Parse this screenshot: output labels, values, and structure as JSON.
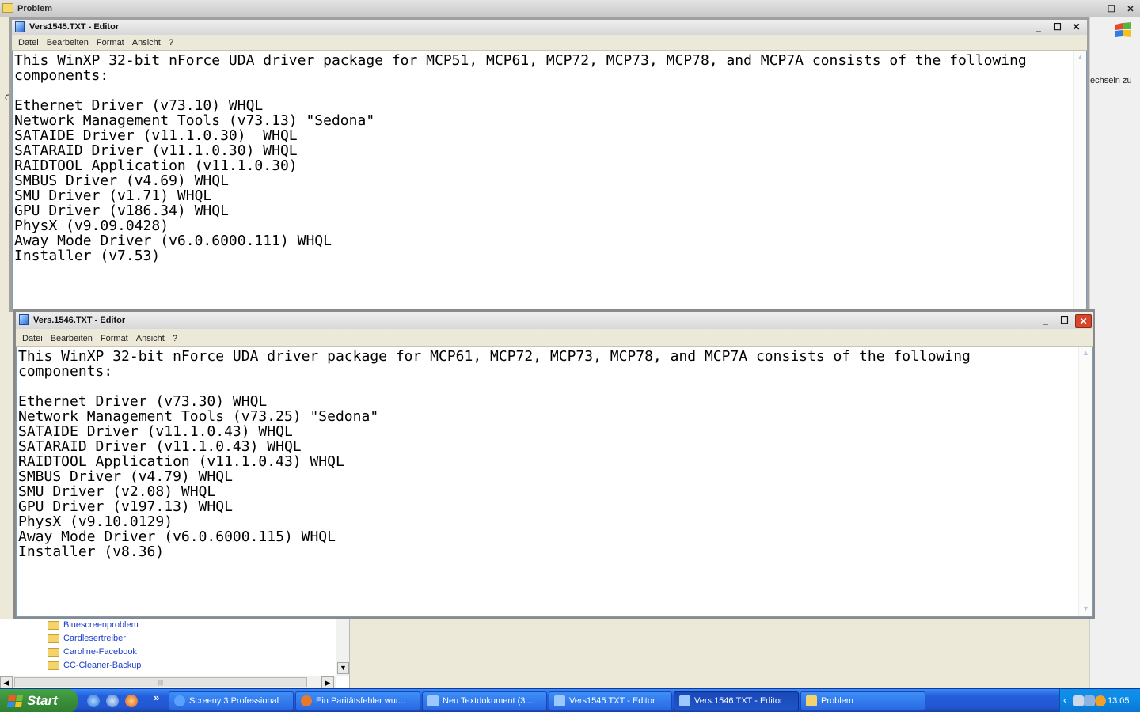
{
  "explorer": {
    "title": "Problem",
    "side_text": "echseln zu",
    "side_left_letter": "O",
    "tree_items": [
      "Bluescreenproblem",
      "Cardlesertreiber",
      "Caroline-Facebook",
      "CC-Cleaner-Backup"
    ]
  },
  "window1": {
    "title": "Vers1545.TXT - Editor",
    "menu": [
      "Datei",
      "Bearbeiten",
      "Format",
      "Ansicht",
      "?"
    ],
    "content": "This WinXP 32-bit nForce UDA driver package for MCP51, MCP61, MCP72, MCP73, MCP78, and MCP7A consists of the following\ncomponents:\n\nEthernet Driver (v73.10) WHQL\nNetwork Management Tools (v73.13) \"Sedona\"\nSATAIDE Driver (v11.1.0.30)  WHQL\nSATARAID Driver (v11.1.0.30) WHQL\nRAIDTOOL Application (v11.1.0.30)\nSMBUS Driver (v4.69) WHQL\nSMU Driver (v1.71) WHQL\nGPU Driver (v186.34) WHQL\nPhysX (v9.09.0428)\nAway Mode Driver (v6.0.6000.111) WHQL\nInstaller (v7.53)"
  },
  "window2": {
    "title": "Vers.1546.TXT - Editor",
    "menu": [
      "Datei",
      "Bearbeiten",
      "Format",
      "Ansicht",
      "?"
    ],
    "content": "This WinXP 32-bit nForce UDA driver package for MCP61, MCP72, MCP73, MCP78, and MCP7A consists of the following\ncomponents:\n\nEthernet Driver (v73.30) WHQL\nNetwork Management Tools (v73.25) \"Sedona\"\nSATAIDE Driver (v11.1.0.43) WHQL\nSATARAID Driver (v11.1.0.43) WHQL\nRAIDTOOL Application (v11.1.0.43) WHQL\nSMBUS Driver (v4.79) WHQL\nSMU Driver (v2.08) WHQL\nGPU Driver (v197.13) WHQL\nPhysX (v9.10.0129)\nAway Mode Driver (v6.0.6000.115) WHQL\nInstaller (v8.36)"
  },
  "taskbar": {
    "start_label": "Start",
    "overflow": "»",
    "buttons": [
      {
        "label": "Screeny 3 Professional",
        "icon": "screeny-icon",
        "color": "#5aa0ff"
      },
      {
        "label": "Ein Paritätsfehler wur...",
        "icon": "firefox-icon",
        "color": "#e8792b"
      },
      {
        "label": "Neu Textdokument (3....",
        "icon": "notepad-icon",
        "color": "#9cc8ff"
      },
      {
        "label": "Vers1545.TXT - Editor",
        "icon": "notepad-icon",
        "color": "#9cc8ff"
      },
      {
        "label": "Vers.1546.TXT - Editor",
        "icon": "notepad-icon",
        "color": "#9cc8ff"
      },
      {
        "label": "Problem",
        "icon": "folder-icon",
        "color": "#f5d36b"
      }
    ],
    "clock": "13:05"
  }
}
